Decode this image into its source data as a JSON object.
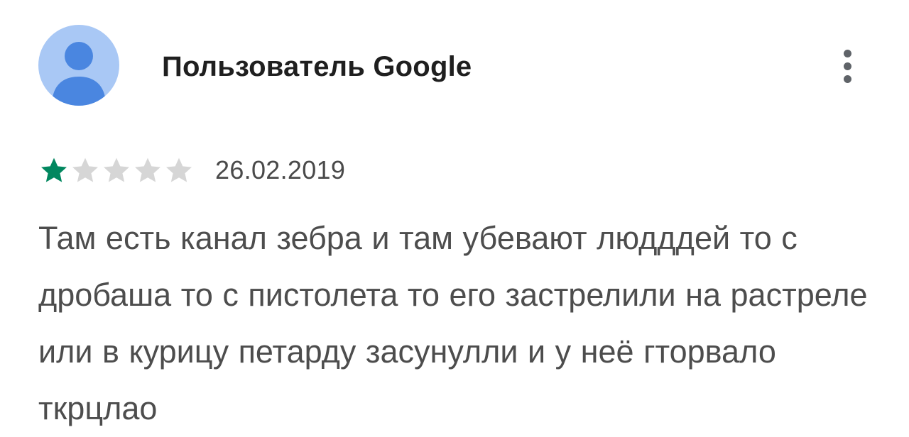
{
  "review": {
    "author": "Пользователь Google",
    "rating": 1,
    "max_rating": 5,
    "date": "26.02.2019",
    "text": "Там есть канал зебра и там убевают людддей то с дробаша то с пистолета то его застрелили на растреле или в курицу петарду засунулли и у неё гторвало ткрцлао"
  },
  "icons": {
    "avatar": "default-user-avatar",
    "menu": "more-vert-icon",
    "star": "star-icon"
  },
  "colors": {
    "star_filled": "#01875f",
    "star_empty": "#d6d6d6",
    "avatar_bg": "#a9c8f5",
    "avatar_figure": "#4a86e0"
  }
}
